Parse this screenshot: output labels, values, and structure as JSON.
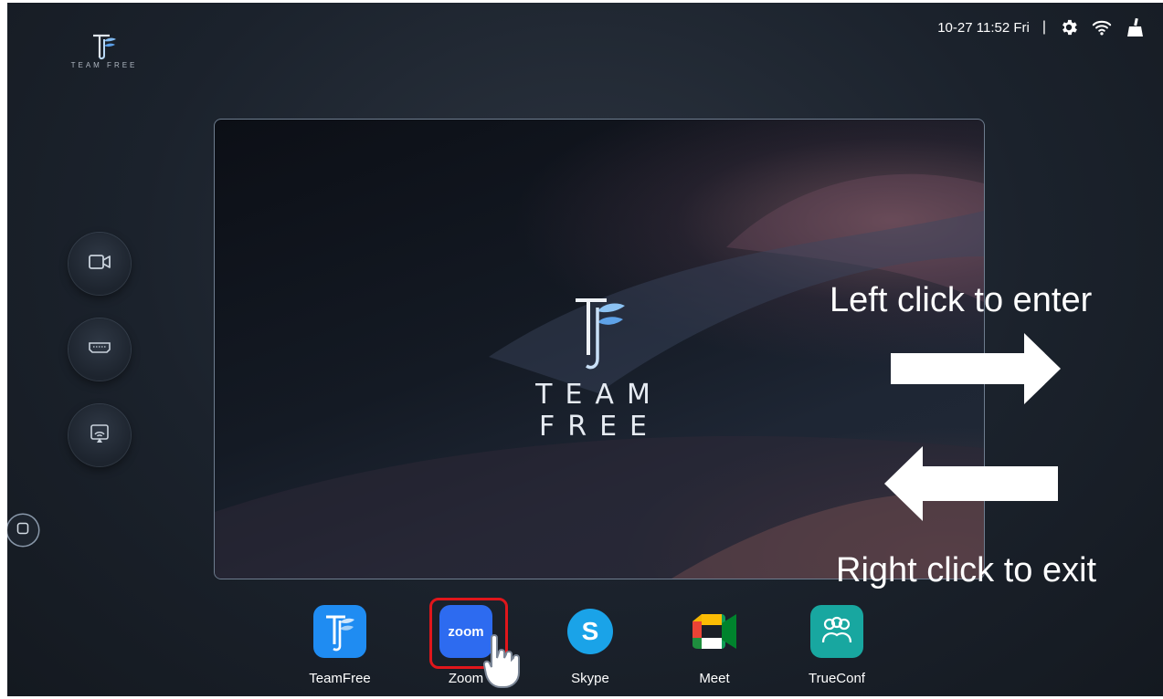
{
  "brand": {
    "name": "TEAM FREE"
  },
  "status": {
    "datetime": "10-27 11:52 Fri",
    "separator": "|"
  },
  "side_buttons": [
    {
      "name": "camera-icon"
    },
    {
      "name": "hdmi-icon"
    },
    {
      "name": "screen-cast-icon"
    }
  ],
  "preview": {
    "brand": "TEAM FREE"
  },
  "annotations": {
    "enter": "Left click to enter",
    "exit": "Right click to exit"
  },
  "dock": {
    "apps": [
      {
        "label": "TeamFree",
        "color": "#1f8cf2"
      },
      {
        "label": "Zoom",
        "color": "#2d6bf0",
        "icon_text": "zoom"
      },
      {
        "label": "Skype",
        "color": "#1aa3e8",
        "icon_text": "S"
      },
      {
        "label": "Meet",
        "color": "#ffffff"
      },
      {
        "label": "TrueConf",
        "color": "#18a7a0"
      }
    ],
    "selected": "Zoom"
  },
  "colors": {
    "highlight": "#e0161b",
    "background": "#1b222c"
  }
}
